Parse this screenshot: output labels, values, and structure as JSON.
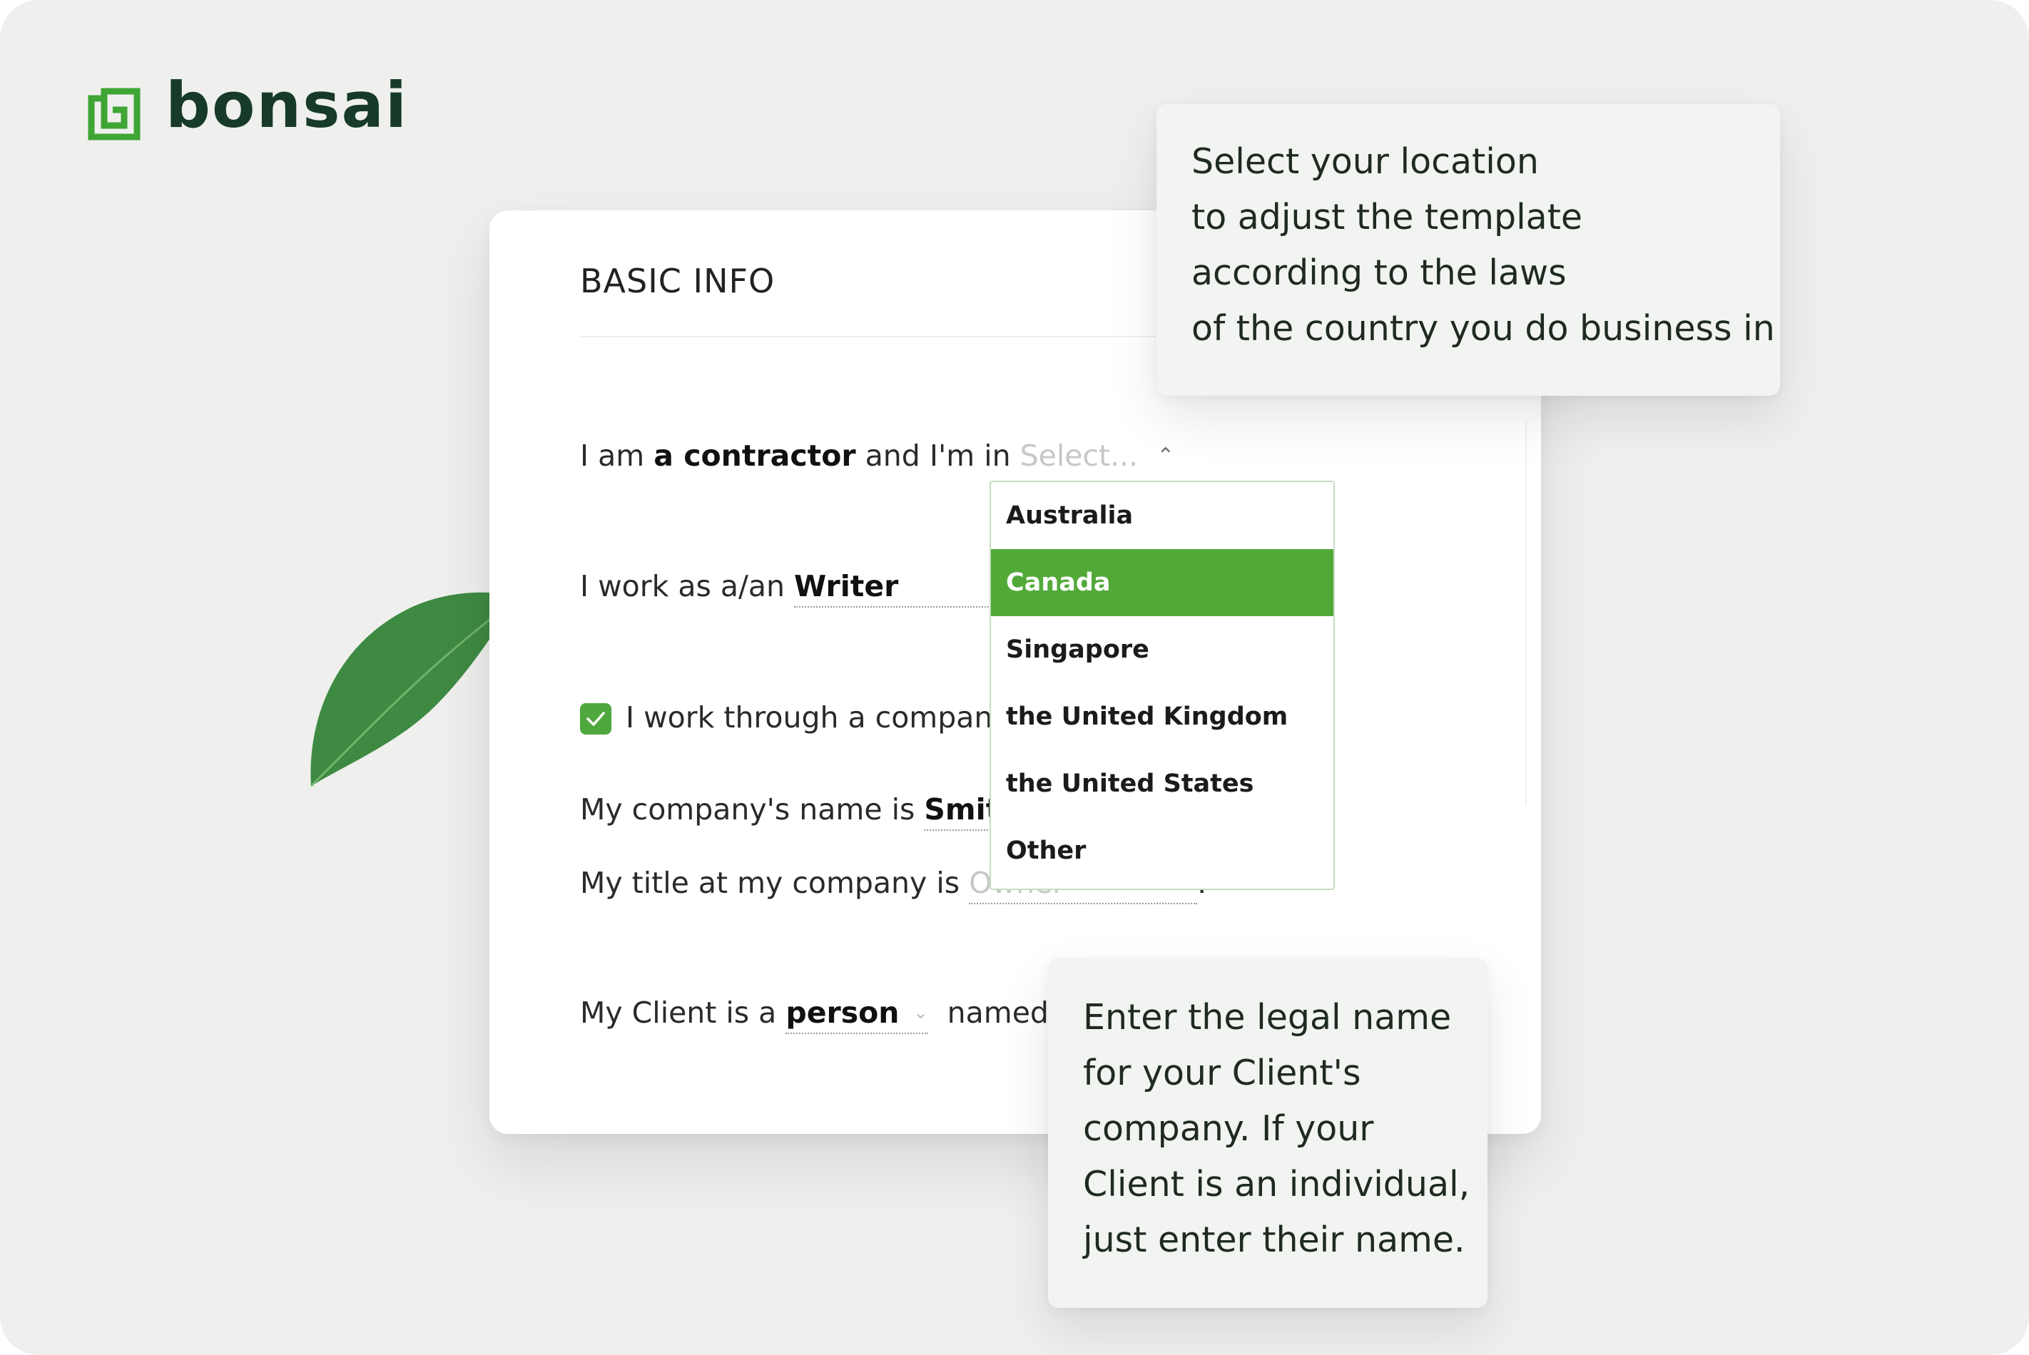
{
  "brand": {
    "name": "bonsai",
    "logo_icon": "bonsai-logo-icon",
    "accent_color": "#52a938",
    "text_color": "#173a2a"
  },
  "card": {
    "title": "BASIC INFO",
    "row1": {
      "prefix": "I am",
      "role": "a contractor",
      "middle": "and I'm in",
      "select_placeholder": "Select...",
      "chevron": "⌃"
    },
    "row2": {
      "label": "I work as a/an",
      "value": "Writer"
    },
    "row3": {
      "label": "I work through a compan",
      "checked": true
    },
    "row4": {
      "label": "My company's name is",
      "value": "Smit"
    },
    "row5": {
      "label": "My title at my company is",
      "placeholder": "Owner",
      "suffix": "."
    },
    "row6": {
      "label": "My Client is a",
      "value": "person",
      "chevron": "⌄",
      "suffix": "named"
    }
  },
  "dropdown": {
    "options": [
      "Australia",
      "Canada",
      "Singapore",
      "the United Kingdom",
      "the United States",
      "Other"
    ],
    "selected": "Canada"
  },
  "tooltips": {
    "location": [
      "Select your location",
      "to adjust the template",
      "according to the laws",
      "of the country you do business in"
    ],
    "client": [
      "Enter the legal name",
      "for your Client's",
      "company. If your",
      "Client is an individual,",
      "just enter their name."
    ]
  }
}
